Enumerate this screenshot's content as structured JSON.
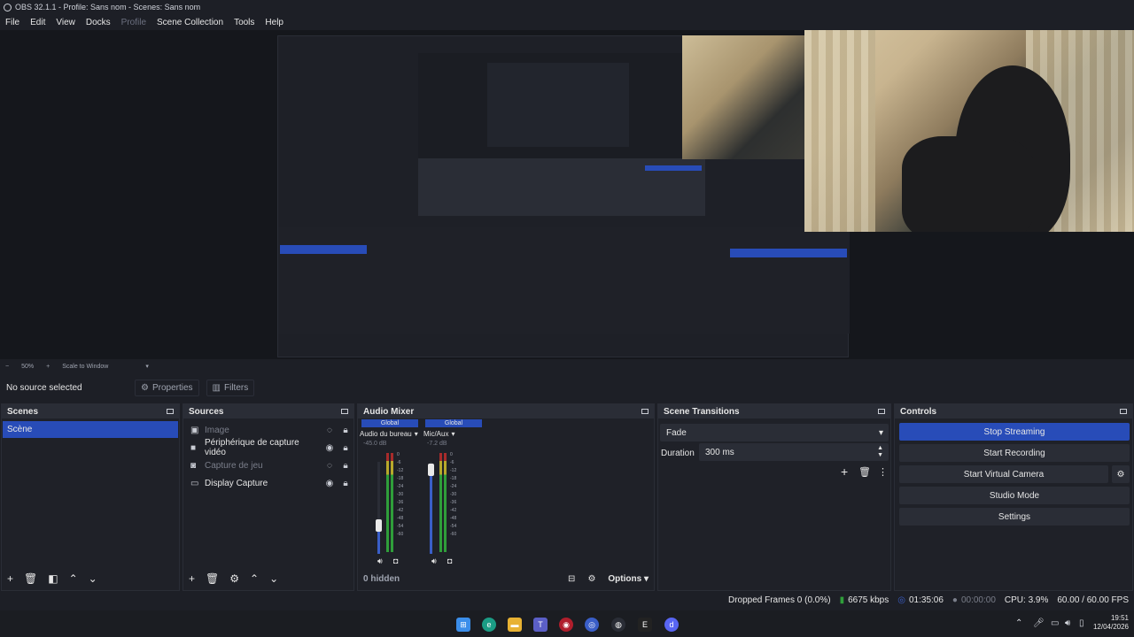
{
  "window": {
    "title": "OBS 32.1.1 - Profile: Sans nom - Scenes: Sans nom"
  },
  "menu": {
    "items": [
      "File",
      "Edit",
      "View",
      "Docks",
      "Profile",
      "Scene Collection",
      "Tools",
      "Help"
    ],
    "disabled_index": 4
  },
  "preview": {
    "zoom_label": "50%",
    "scale_label": "Scale to Window",
    "minus": "−",
    "plus": "+"
  },
  "source_toolbar": {
    "no_source": "No source selected",
    "properties": "Properties",
    "filters": "Filters"
  },
  "scenes": {
    "title": "Scenes",
    "items": [
      "Scène"
    ]
  },
  "sources": {
    "title": "Sources",
    "items": [
      {
        "label": "Image",
        "icon": "image-icon",
        "visible": false
      },
      {
        "label": "Périphérique de capture vidéo",
        "icon": "camera-icon",
        "visible": true
      },
      {
        "label": "Capture de jeu",
        "icon": "gamepad-icon",
        "visible": false
      },
      {
        "label": "Display Capture",
        "icon": "monitor-icon",
        "visible": true
      }
    ]
  },
  "audio_mixer": {
    "title": "Audio Mixer",
    "channels": [
      {
        "badge": "Global",
        "name": "Audio du bureau",
        "db": "-45.0 dB",
        "fader_level": 0.18
      },
      {
        "badge": "Global",
        "name": "Mic/Aux",
        "db": "-7.2 dB",
        "fader_level": 0.78
      }
    ],
    "scale": [
      "0",
      "-6",
      "-12",
      "-18",
      "-24",
      "-30",
      "-36",
      "-42",
      "-48",
      "-54",
      "-60"
    ],
    "footer_hidden": "0 hidden",
    "options": "Options"
  },
  "transitions": {
    "title": "Scene Transitions",
    "selected": "Fade",
    "duration_label": "Duration",
    "duration_value": "300 ms"
  },
  "controls": {
    "title": "Controls",
    "stop_streaming": "Stop Streaming",
    "start_recording": "Start Recording",
    "start_virtual_camera": "Start Virtual Camera",
    "studio_mode": "Studio Mode",
    "settings": "Settings"
  },
  "status": {
    "dropped_frames": "Dropped Frames 0 (0.0%)",
    "bitrate": "6675 kbps",
    "stream_time": "01:35:06",
    "record_time": "00:00:00",
    "cpu": "CPU: 3.9%",
    "fps": "60.00 / 60.00 FPS"
  },
  "taskbar": {
    "time": "19:51",
    "date": "12/04/2026"
  },
  "colors": {
    "accent": "#284cb8",
    "background": "#1d1f26",
    "panel": "#1f2128"
  }
}
